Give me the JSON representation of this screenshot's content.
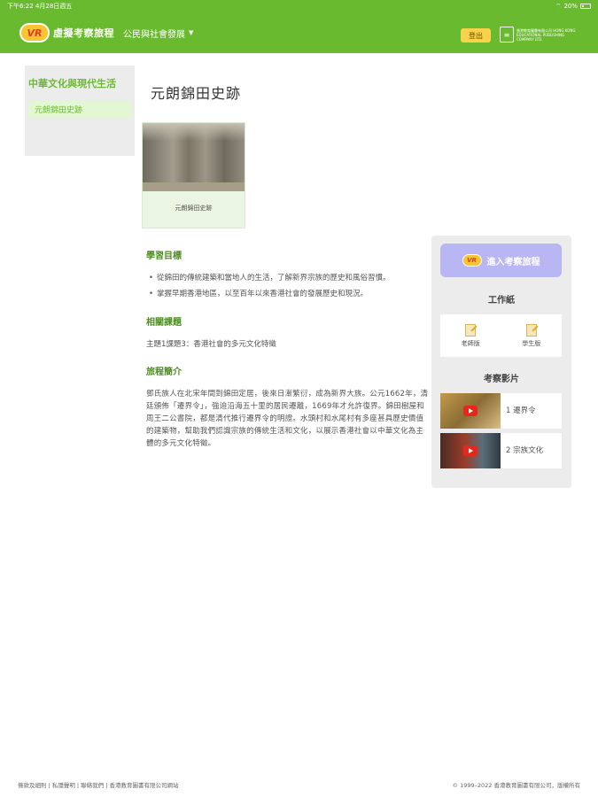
{
  "status_bar": {
    "time_date": "下午6:22 4月28日週五",
    "battery_text": "20%"
  },
  "header": {
    "logo_badge": "VR",
    "logo_text": "虛擬考察旅程",
    "subject_menu": "公民與社會發展",
    "logout": "登出",
    "publisher_lines": "香港教育圖書有限公司 HONG KONG EDUCATIONAL PUBLISHING COMPANY LTD."
  },
  "sidebar": {
    "title": "中華文化與現代生活",
    "items": [
      {
        "label": "元朗錦田史跡"
      }
    ]
  },
  "main": {
    "page_title": "元朗錦田史跡",
    "thumbnail_label": "元朗錦田史跡",
    "objectives_heading": "學習目標",
    "objectives": [
      "從錦田的傳統建築和當地人的生活，了解新界宗族的歷史和風俗習慣。",
      "掌握早期香港地區，以至百年以來香港社會的發展歷史和現況。"
    ],
    "topics_heading": "相關課題",
    "topic": "主題1課題3：香港社會的多元文化特徵",
    "intro_heading": "旅程簡介",
    "intro": "鄧氏族人在北宋年間到錦田定居，後來日漸繁衍，成為新界大族。公元1662年，清廷頒佈「遷界令」，強迫沿海五十里的居民遷離，1669年才允許復界。錦田樹屋和周王二公書院，都是清代推行遷界令的明證。水頭村和水尾村有多座甚具歷史價值的建築物，幫助我們認識宗族的傳統生活和文化，以展示香港社會以中華文化為主體的多元文化特徵。"
  },
  "right_panel": {
    "enter_button": "進入考察旅程",
    "enter_badge": "VR",
    "worksheets_heading": "工作紙",
    "worksheets": [
      {
        "label": "老師版"
      },
      {
        "label": "學生版"
      }
    ],
    "videos_heading": "考察影片",
    "videos": [
      {
        "title": "1 遷界令"
      },
      {
        "title": "2 宗族文化"
      }
    ]
  },
  "footer": {
    "links": "條款及細則 | 私隱聲明 | 聯絡我們 | 香港教育圖書有限公司網站",
    "copyright": "© 1999–2022 香港教育圖書有限公司，版權所有"
  },
  "colors": {
    "brand_green": "#6aba2f",
    "heading_green": "#4e8d22",
    "enter_button_purple": "#b9b6f4",
    "logout_yellow": "#f7d24a"
  }
}
